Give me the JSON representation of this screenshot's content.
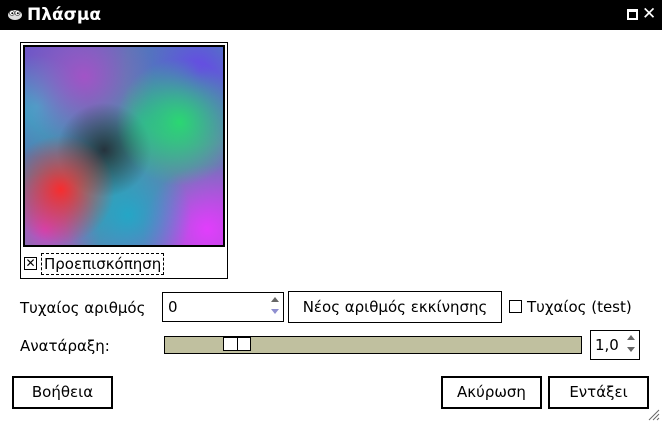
{
  "window": {
    "title": "Πλάσμα"
  },
  "preview": {
    "checkbox_checked": true,
    "label": "Προεπισκόπηση"
  },
  "random_seed": {
    "label": "Τυχαίος αριθμός",
    "value": "0",
    "new_seed_button": "Νέος αριθμός εκκίνησης",
    "randomize_label": "Τυχαίος (test)",
    "randomize_checked": false
  },
  "turbulence": {
    "label": "Ανατάραξη:",
    "value": "1,0",
    "slider_fraction": 0.15
  },
  "buttons": {
    "help": "Βοήθεια",
    "cancel": "Ακύρωση",
    "ok": "Εντάξει"
  },
  "colors": {
    "titlebar": "#000000",
    "slider_trough": "#c0c09f"
  }
}
